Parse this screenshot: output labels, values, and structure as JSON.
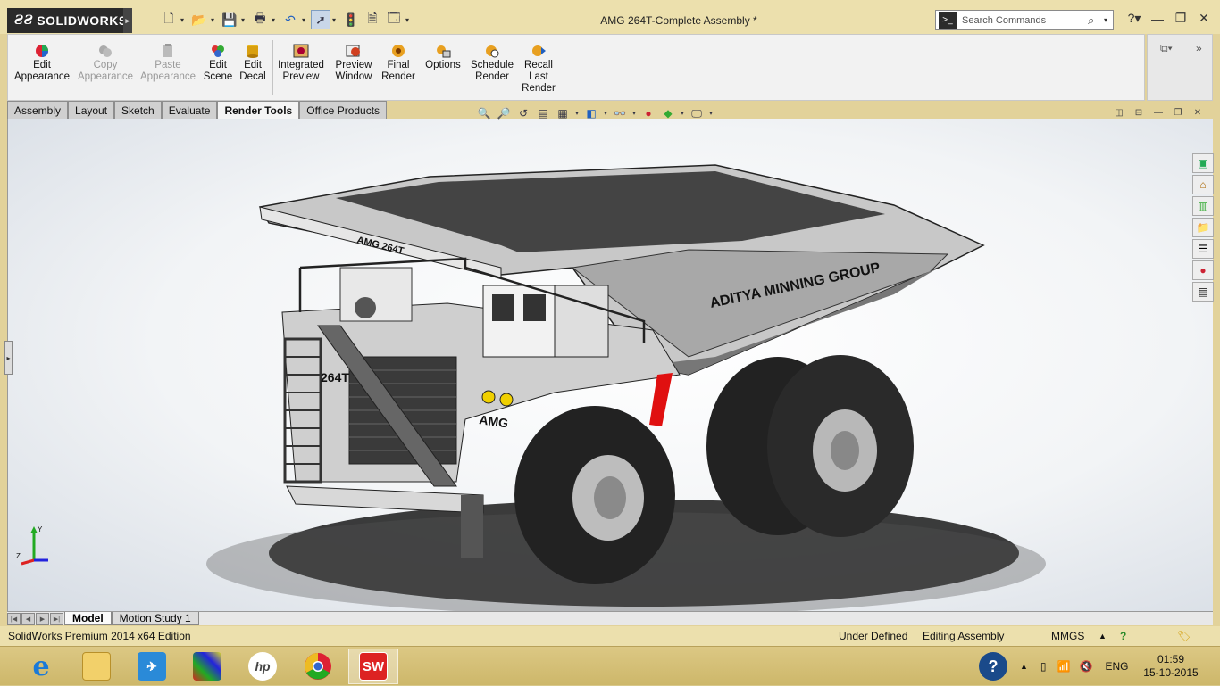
{
  "app": {
    "brand": "SOLIDWORKS",
    "document_title": "AMG 264T-Complete Assembly *",
    "search_placeholder": "Search Commands"
  },
  "quick_access": [
    "new-icon",
    "open-icon",
    "save-icon",
    "print-icon",
    "undo-icon",
    "select-icon",
    "rebuild-icon",
    "file-properties-icon",
    "options-icon"
  ],
  "ribbon": {
    "edit_appearance": [
      "Edit",
      "Appearance"
    ],
    "copy_appearance": [
      "Copy",
      "Appearance"
    ],
    "paste_appearance": [
      "Paste",
      "Appearance"
    ],
    "edit_scene": [
      "Edit",
      "Scene"
    ],
    "edit_decal": [
      "Edit",
      "Decal"
    ],
    "integrated_preview": [
      "Integrated",
      "Preview"
    ],
    "preview_window": [
      "Preview",
      "Window"
    ],
    "final_render": [
      "Final",
      "Render"
    ],
    "options": [
      "Options"
    ],
    "schedule_render": [
      "Schedule",
      "Render"
    ],
    "recall_last_render": [
      "Recall",
      "Last",
      "Render"
    ]
  },
  "tabs": [
    "Assembly",
    "Layout",
    "Sketch",
    "Evaluate",
    "Render Tools",
    "Office Products"
  ],
  "active_tab": "Render Tools",
  "model": {
    "dump_body_text": "ADITYA MINNING GROUP",
    "canopy_text": "AMG 264T",
    "grille_text": "264T",
    "front_plate_text": "AMG",
    "triad": {
      "y": "Y",
      "x": "X",
      "z": "Z"
    }
  },
  "bottom_tabs": [
    "Model",
    "Motion Study 1"
  ],
  "status": {
    "edition": "SolidWorks Premium 2014 x64 Edition",
    "definition": "Under Defined",
    "mode": "Editing Assembly",
    "units": "MMGS"
  },
  "taskbar": {
    "language": "ENG",
    "time": "01:59",
    "date": "15-10-2015",
    "apps": [
      "internet-explorer-icon",
      "file-explorer-icon",
      "app-rocket-icon",
      "puzzle-icon",
      "hp-icon",
      "chrome-icon",
      "solidworks-icon"
    ]
  }
}
